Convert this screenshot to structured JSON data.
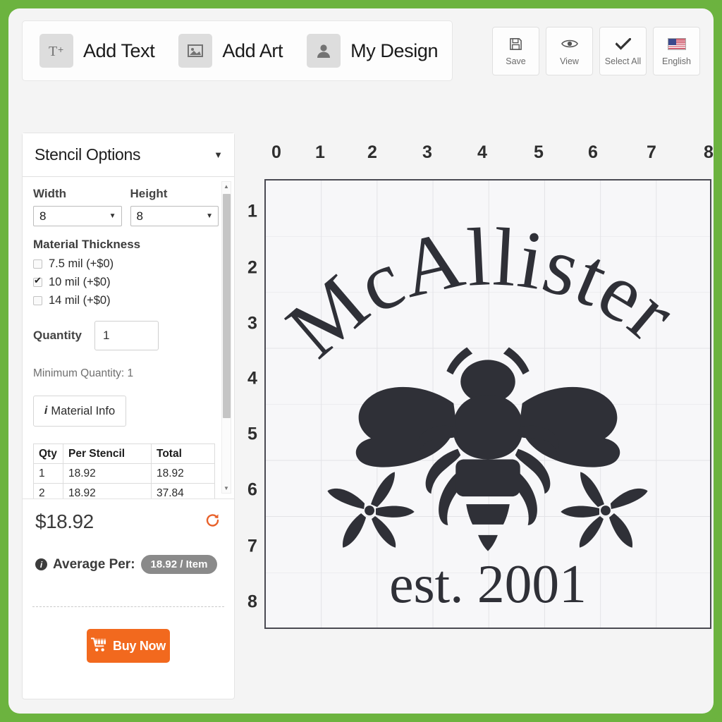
{
  "theme": {
    "frame_color": "#6cb33f",
    "accent_orange": "#f2691e",
    "art_color": "#2f3037"
  },
  "toolbar": {
    "primary_items": [
      {
        "icon": "add-text-icon",
        "label": "Add Text"
      },
      {
        "icon": "add-art-icon",
        "label": "Add Art"
      },
      {
        "icon": "my-design-icon",
        "label": "My Design"
      }
    ],
    "actions": [
      {
        "icon": "save-icon",
        "label": "Save"
      },
      {
        "icon": "eye-icon",
        "label": "View"
      },
      {
        "icon": "check-icon",
        "label": "Select All"
      },
      {
        "icon": "us-flag-icon",
        "label": "English"
      }
    ]
  },
  "options_panel": {
    "header_title": "Stencil Options",
    "header_caret": "▼",
    "width": {
      "label": "Width",
      "value": "8"
    },
    "height": {
      "label": "Height",
      "value": "8"
    },
    "material_thickness": {
      "title": "Material Thickness",
      "options": [
        {
          "label": "7.5 mil (+$0)",
          "checked": false
        },
        {
          "label": "10 mil (+$0)",
          "checked": true
        },
        {
          "label": "14 mil (+$0)",
          "checked": false
        }
      ]
    },
    "quantity": {
      "label": "Quantity",
      "value": "1"
    },
    "minimum_quantity": "Minimum Quantity: 1",
    "material_info_button": "Material Info",
    "price_table": {
      "headers": [
        "Qty",
        "Per Stencil",
        "Total"
      ],
      "rows": [
        [
          "1",
          "18.92",
          "18.92"
        ],
        [
          "2",
          "18.92",
          "37.84"
        ]
      ]
    }
  },
  "price_summary": {
    "total": "$18.92",
    "refresh_icon": "refresh-icon",
    "average_label": "Average Per:",
    "average_value": "18.92 / Item",
    "buy_button": "Buy Now",
    "buy_icon": "shopping-cart-icon"
  },
  "design_canvas": {
    "ruler_top": [
      "0",
      "1",
      "2",
      "3",
      "4",
      "5",
      "6",
      "7",
      "8"
    ],
    "ruler_left": [
      "1",
      "2",
      "3",
      "4",
      "5",
      "6",
      "7",
      "8"
    ],
    "grid_columns": 8,
    "grid_rows": 8,
    "artwork": {
      "arched_text": "McAllister",
      "bottom_text": "est. 2001",
      "motifs": [
        "bee-silhouette",
        "flower-left",
        "flower-right"
      ]
    }
  }
}
